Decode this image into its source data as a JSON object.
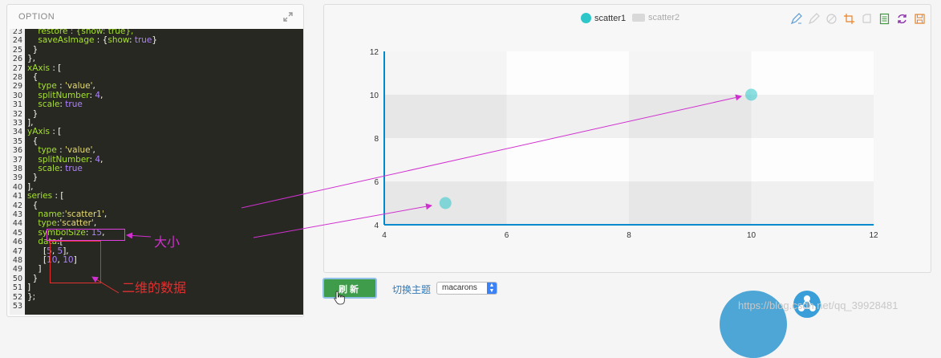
{
  "option_panel": {
    "header": "OPTION",
    "first_line_number": 23,
    "lines": [
      [
        [
          "k",
          "    restore : {show: true},"
        ]
      ],
      [
        [
          "k",
          "    saveAsImage"
        ],
        [
          "p",
          " : {"
        ],
        [
          "k",
          "show"
        ],
        [
          "p",
          ": "
        ],
        [
          "n",
          "true"
        ],
        [
          "p",
          "}"
        ]
      ],
      [
        [
          "p",
          "  }"
        ]
      ],
      [
        [
          "p",
          "},"
        ]
      ],
      [
        [
          "k",
          "xAxis"
        ],
        [
          "p",
          " : ["
        ]
      ],
      [
        [
          "p",
          "  {"
        ]
      ],
      [
        [
          "k",
          "    type"
        ],
        [
          "p",
          " : "
        ],
        [
          "s",
          "'value'"
        ],
        [
          "p",
          ","
        ]
      ],
      [
        [
          "k",
          "    splitNumber"
        ],
        [
          "p",
          ": "
        ],
        [
          "n",
          "4"
        ],
        [
          "p",
          ","
        ]
      ],
      [
        [
          "k",
          "    scale"
        ],
        [
          "p",
          ": "
        ],
        [
          "n",
          "true"
        ]
      ],
      [
        [
          "p",
          "  }"
        ]
      ],
      [
        [
          "p",
          "],"
        ]
      ],
      [
        [
          "k",
          "yAxis"
        ],
        [
          "p",
          " : ["
        ]
      ],
      [
        [
          "p",
          "  {"
        ]
      ],
      [
        [
          "k",
          "    type"
        ],
        [
          "p",
          " : "
        ],
        [
          "s",
          "'value'"
        ],
        [
          "p",
          ","
        ]
      ],
      [
        [
          "k",
          "    splitNumber"
        ],
        [
          "p",
          ": "
        ],
        [
          "n",
          "4"
        ],
        [
          "p",
          ","
        ]
      ],
      [
        [
          "k",
          "    scale"
        ],
        [
          "p",
          ": "
        ],
        [
          "n",
          "true"
        ]
      ],
      [
        [
          "p",
          "  }"
        ]
      ],
      [
        [
          "p",
          "],"
        ]
      ],
      [
        [
          "k",
          "series"
        ],
        [
          "p",
          " : ["
        ]
      ],
      [
        [
          "p",
          "  {"
        ]
      ],
      [
        [
          "k",
          "    name"
        ],
        [
          "p",
          ":"
        ],
        [
          "s",
          "'scatter1'"
        ],
        [
          "p",
          ","
        ]
      ],
      [
        [
          "k",
          "    type"
        ],
        [
          "p",
          ":"
        ],
        [
          "s",
          "'scatter'"
        ],
        [
          "p",
          ","
        ]
      ],
      [
        [
          "k",
          "    symbolSize"
        ],
        [
          "p",
          ": "
        ],
        [
          "n",
          "15"
        ],
        [
          "p",
          ","
        ]
      ],
      [
        [
          "k",
          "    data"
        ],
        [
          "p",
          ":["
        ]
      ],
      [
        [
          "p",
          "      ["
        ],
        [
          "n",
          "5"
        ],
        [
          "p",
          ", "
        ],
        [
          "n",
          "5"
        ],
        [
          "p",
          "],"
        ]
      ],
      [
        [
          "p",
          "      ["
        ],
        [
          "n",
          "10"
        ],
        [
          "p",
          ", "
        ],
        [
          "n",
          "10"
        ],
        [
          "p",
          "]"
        ]
      ],
      [
        [
          "p",
          "    ]"
        ]
      ],
      [
        [
          "p",
          "  }"
        ]
      ],
      [
        [
          "p",
          "]"
        ]
      ],
      [
        [
          "p",
          "};"
        ]
      ],
      [
        [
          "p",
          ""
        ]
      ]
    ]
  },
  "annotations": {
    "size_label": "大小",
    "data_label": "二维的数据",
    "arrow_color": "#d030d0",
    "box_color": "#e03030"
  },
  "chart_data": {
    "type": "scatter",
    "series": [
      {
        "name": "scatter1",
        "points": [
          [
            5,
            5
          ],
          [
            10,
            10
          ]
        ],
        "symbol_size": 15,
        "color": "#2ec7c9",
        "visible": true
      },
      {
        "name": "scatter2",
        "points": [],
        "color": "#cccccc",
        "visible": false
      }
    ],
    "x_ticks": [
      "4",
      "6",
      "8",
      "10",
      "12"
    ],
    "y_ticks": [
      "4",
      "6",
      "8",
      "10",
      "12"
    ],
    "xlim": [
      4,
      12
    ],
    "ylim": [
      4,
      12
    ],
    "grid": true,
    "legend": "top-center",
    "axis_color": "#008acd"
  },
  "toolbox": {
    "icons": [
      "mark-pen-icon",
      "mark-undo-icon",
      "mark-clear-icon",
      "data-zoom-icon",
      "data-zoom-reset-icon",
      "data-view-icon",
      "restore-icon",
      "save-as-image-icon"
    ]
  },
  "controls": {
    "refresh_label": "刷新",
    "theme_label": "切换主题",
    "theme_value": "macarons"
  },
  "watermark": "https://blog.csdn.net/qq_39928481"
}
